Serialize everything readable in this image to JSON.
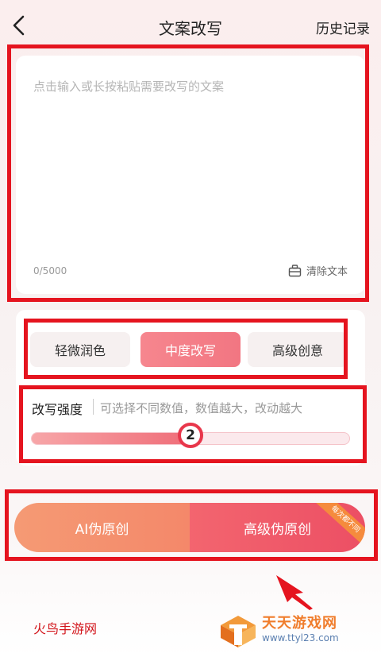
{
  "header": {
    "title": "文案改写",
    "history_label": "历史记录"
  },
  "editor": {
    "placeholder": "点击输入或长按粘贴需要改写的文案",
    "value": "",
    "char_count": "0/5000",
    "clear_label": "清除文本"
  },
  "modes": [
    {
      "label": "轻微润色",
      "active": false
    },
    {
      "label": "中度改写",
      "active": true
    },
    {
      "label": "高级创意",
      "active": false
    }
  ],
  "strength": {
    "label": "改写强度",
    "hint": "可选择不同数值，数值越大，改动越大",
    "value": 2,
    "value_text": "2",
    "min": 0,
    "max": 4
  },
  "actions": {
    "ai_label": "AI伪原创",
    "pro_label": "高级伪原创",
    "ribbon_label": "每次都不同"
  },
  "watermarks": {
    "left": "火鸟手游网",
    "right_name": "天天游戏网",
    "right_url": "www.ttyl23.com"
  },
  "colors": {
    "accent": "#ef6d78",
    "annotation_red": "#e5141f",
    "ai_orange": "#f59a74",
    "pro_red": "#ec4f64"
  }
}
